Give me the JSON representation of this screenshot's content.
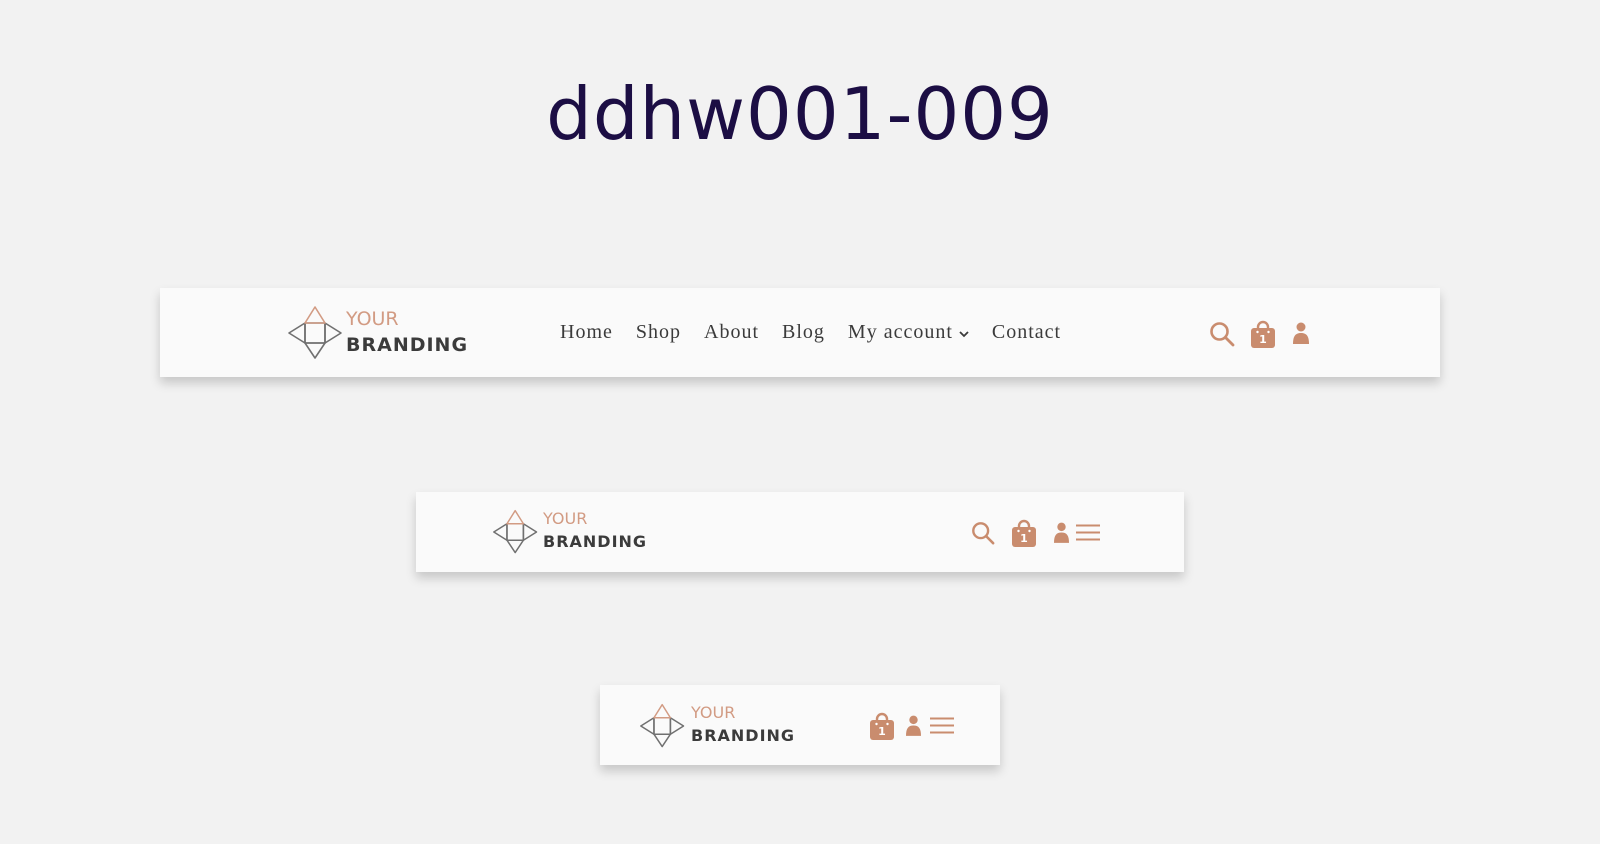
{
  "page": {
    "title": "ddhw001-009"
  },
  "logo": {
    "line1": "YOUR",
    "line2": "BRANDING"
  },
  "nav": {
    "items": [
      "Home",
      "Shop",
      "About",
      "Blog",
      "My account",
      "Contact"
    ]
  },
  "cart": {
    "count": "1"
  },
  "icons": {
    "search": "search-icon",
    "cart": "shopping-bag-icon",
    "account": "user-icon",
    "menu": "hamburger-menu-icon",
    "dropdown": "chevron-down-icon"
  },
  "colors": {
    "background": "#f2f2f2",
    "header": "#fafafa",
    "accent": "#c98c6e",
    "logo_accent": "#d29b83",
    "text": "#3b3b3b",
    "title": "#1c0e44"
  }
}
